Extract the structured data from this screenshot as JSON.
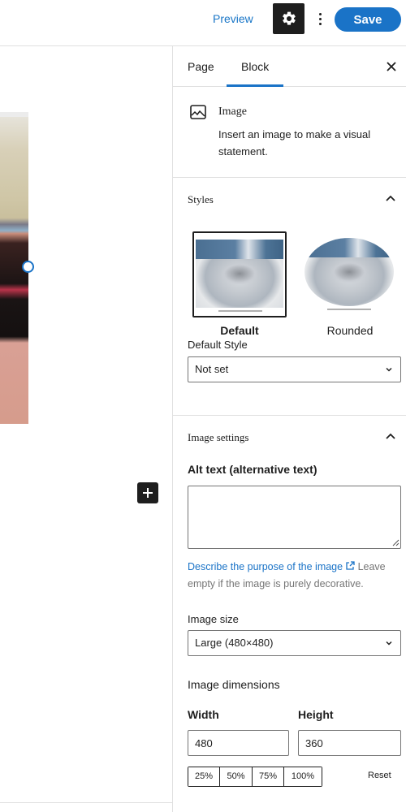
{
  "topbar": {
    "preview_label": "Preview",
    "settings_icon": "gear-icon",
    "more_icon": "vertical-ellipsis-icon",
    "save_label": "Save",
    "accent_color": "#1a73c7"
  },
  "canvas": {
    "image_alt": "Selected image block (cropped)",
    "add_block_icon": "plus-icon"
  },
  "sidebar": {
    "tabs": [
      {
        "label": "Page",
        "active": false
      },
      {
        "label": "Block",
        "active": true
      }
    ],
    "close_icon": "close-icon",
    "block_card": {
      "icon": "image-icon",
      "title": "Image",
      "description": "Insert an image to make a visual statement."
    },
    "styles_panel": {
      "title": "Styles",
      "expanded": true,
      "options": [
        {
          "label": "Default",
          "selected": true
        },
        {
          "label": "Rounded",
          "selected": false
        }
      ],
      "default_style_label": "Default Style",
      "default_style_value": "Not set"
    },
    "image_settings": {
      "title": "Image settings",
      "expanded": true,
      "alt_label": "Alt text (alternative text)",
      "alt_value": "",
      "alt_help_link": "Describe the purpose of the image",
      "alt_help_text": "Leave empty if the image is purely decorative.",
      "size_label": "Image size",
      "size_value": "Large (480×480)",
      "dimensions_label": "Image dimensions",
      "width_label": "Width",
      "width_value": "480",
      "height_label": "Height",
      "height_value": "360",
      "percent_options": [
        "25%",
        "50%",
        "75%",
        "100%"
      ],
      "reset_label": "Reset"
    }
  }
}
